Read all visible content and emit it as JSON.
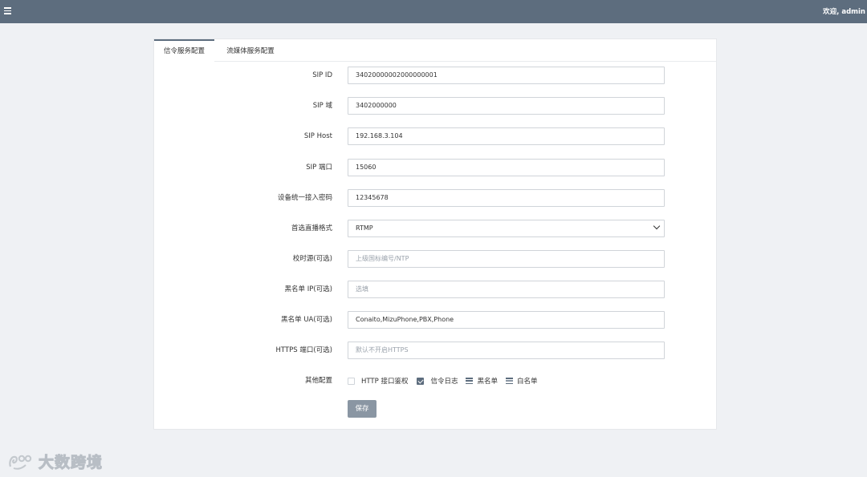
{
  "header": {
    "welcome": "欢迎, admin",
    "menu_icon": "hamburger-icon",
    "bg_color": "#5d6d7e"
  },
  "tabs": [
    {
      "label": "信令服务配置",
      "active": true
    },
    {
      "label": "流媒体服务配置",
      "active": false
    }
  ],
  "form": {
    "sip_id": {
      "label": "SIP ID",
      "value": "34020000002000000001"
    },
    "sip_domain": {
      "label": "SIP 域",
      "value": "3402000000"
    },
    "sip_host": {
      "label": "SIP Host",
      "value": "192.168.3.104"
    },
    "sip_port": {
      "label": "SIP 端口",
      "value": "15060"
    },
    "device_password": {
      "label": "设备统一接入密码",
      "value": "12345678"
    },
    "stream_format": {
      "label": "首选直播格式",
      "value": "RTMP"
    },
    "time_source": {
      "label": "校时源(可选)",
      "placeholder": "上级国标编号/NTP"
    },
    "blacklist_ip": {
      "label": "黑名单 IP(可选)",
      "placeholder": "选填"
    },
    "blacklist_ua": {
      "label": "黑名单 UA(可选)",
      "value": "Conaito,MizuPhone,PBX,Phone"
    },
    "https_port": {
      "label": "HTTPS 端口(可选)",
      "placeholder": "默认不开启HTTPS"
    },
    "other": {
      "label": "其他配置",
      "http_auth": {
        "label": "HTTP 接口鉴权",
        "checked": false
      },
      "signal_log": {
        "label": "信令日志",
        "checked": true
      },
      "blacklist": {
        "label": "黑名单",
        "icon": "list-icon"
      },
      "whitelist": {
        "label": "白名单",
        "icon": "list-alt-icon"
      }
    },
    "save_label": "保存"
  },
  "watermark": {
    "text": "大数跨境"
  }
}
